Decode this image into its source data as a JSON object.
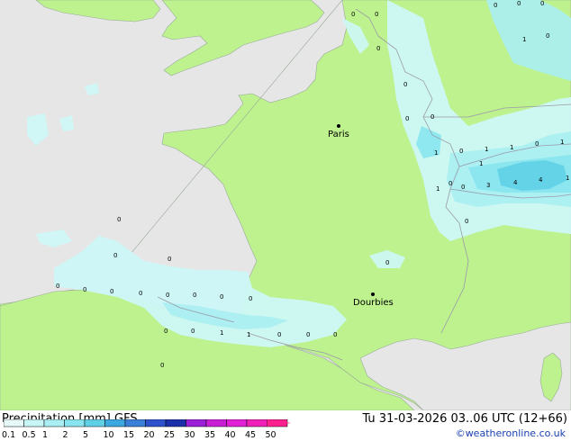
{
  "map": {
    "cities": [
      {
        "name": "Paris"
      },
      {
        "name": "Dourbies"
      }
    ],
    "point_values": [
      "0",
      "0",
      "0",
      "0",
      "0",
      "0",
      "0",
      "0",
      "0",
      "0",
      "0",
      "0",
      "0",
      "0",
      "0",
      "0",
      "0",
      "0",
      "0",
      "0",
      "0",
      "0",
      "0",
      "0",
      "1",
      "1",
      "1",
      "1",
      "1",
      "1",
      "1",
      "3",
      "4",
      "4",
      "1",
      "0",
      "0",
      "0",
      "0",
      "0",
      "0",
      "1",
      "1",
      "0",
      "0",
      "0"
    ]
  },
  "footer": {
    "title": "Precipitation [mm] GFS",
    "date": "Tu 31-03-2026 03..06 UTC (12+66)",
    "credit": "©weatheronline.co.uk",
    "scale": {
      "labels": [
        "0.1",
        "0.5",
        "1",
        "2",
        "5",
        "10",
        "15",
        "20",
        "25",
        "30",
        "35",
        "40",
        "45",
        "50"
      ],
      "colors": [
        "#e6fafa",
        "#c8f5f5",
        "#a8eef2",
        "#88e4ee",
        "#60d0e6",
        "#3da8e0",
        "#3a7fd8",
        "#2e52cc",
        "#1a2fa8",
        "#9b1fd6",
        "#c81fd6",
        "#e11fd6",
        "#f01fb8",
        "#ff2090"
      ]
    }
  }
}
